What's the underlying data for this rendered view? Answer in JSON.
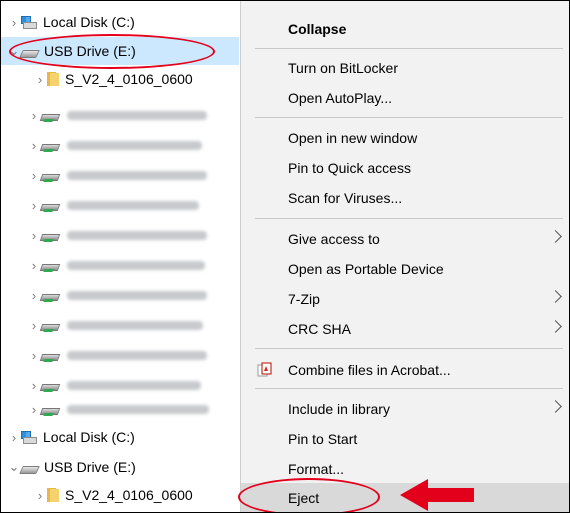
{
  "tree": {
    "items": [
      {
        "label": "Local Disk (C:)",
        "icon": "local-disk-icon",
        "expanded": false
      },
      {
        "label": "USB Drive (E:)",
        "icon": "usb-drive-icon",
        "expanded": true,
        "selected": true
      },
      {
        "label": "S_V2_4_0106_0600",
        "icon": "folder-icon",
        "expanded": false
      },
      {
        "label": "",
        "icon": "network-drive-icon"
      },
      {
        "label": "",
        "icon": "network-drive-icon"
      },
      {
        "label": "",
        "icon": "network-drive-icon"
      },
      {
        "label": "",
        "icon": "network-drive-icon"
      },
      {
        "label": "",
        "icon": "network-drive-icon"
      },
      {
        "label": "",
        "icon": "network-drive-icon"
      },
      {
        "label": "",
        "icon": "network-drive-icon"
      },
      {
        "label": "",
        "icon": "network-drive-icon"
      },
      {
        "label": "",
        "icon": "network-drive-icon"
      },
      {
        "label": "",
        "icon": "network-drive-icon"
      },
      {
        "label": "",
        "icon": "network-drive-icon"
      },
      {
        "label": "Local Disk (C:)",
        "icon": "local-disk-icon",
        "expanded": false
      },
      {
        "label": "USB Drive (E:)",
        "icon": "usb-drive-icon",
        "expanded": true
      },
      {
        "label": "S_V2_4_0106_0600",
        "icon": "folder-icon",
        "expanded": false
      }
    ]
  },
  "menu": {
    "collapse": "Collapse",
    "turn_on_bitlocker": "Turn on BitLocker",
    "open_autoplay": "Open AutoPlay...",
    "open_new_window": "Open in new window",
    "pin_quick_access": "Pin to Quick access",
    "scan_viruses": "Scan for Viruses...",
    "give_access": "Give access to",
    "open_portable": "Open as Portable Device",
    "seven_zip": "7-Zip",
    "crc_sha": "CRC SHA",
    "combine_acrobat": "Combine files in Acrobat...",
    "include_library": "Include in library",
    "pin_start": "Pin to Start",
    "format": "Format...",
    "eject": "Eject"
  },
  "colors": {
    "selection": "#cce8ff",
    "menu_background": "#f2f2f2",
    "highlight": "#d9d9d9",
    "annotation_red": "#e3001b"
  }
}
